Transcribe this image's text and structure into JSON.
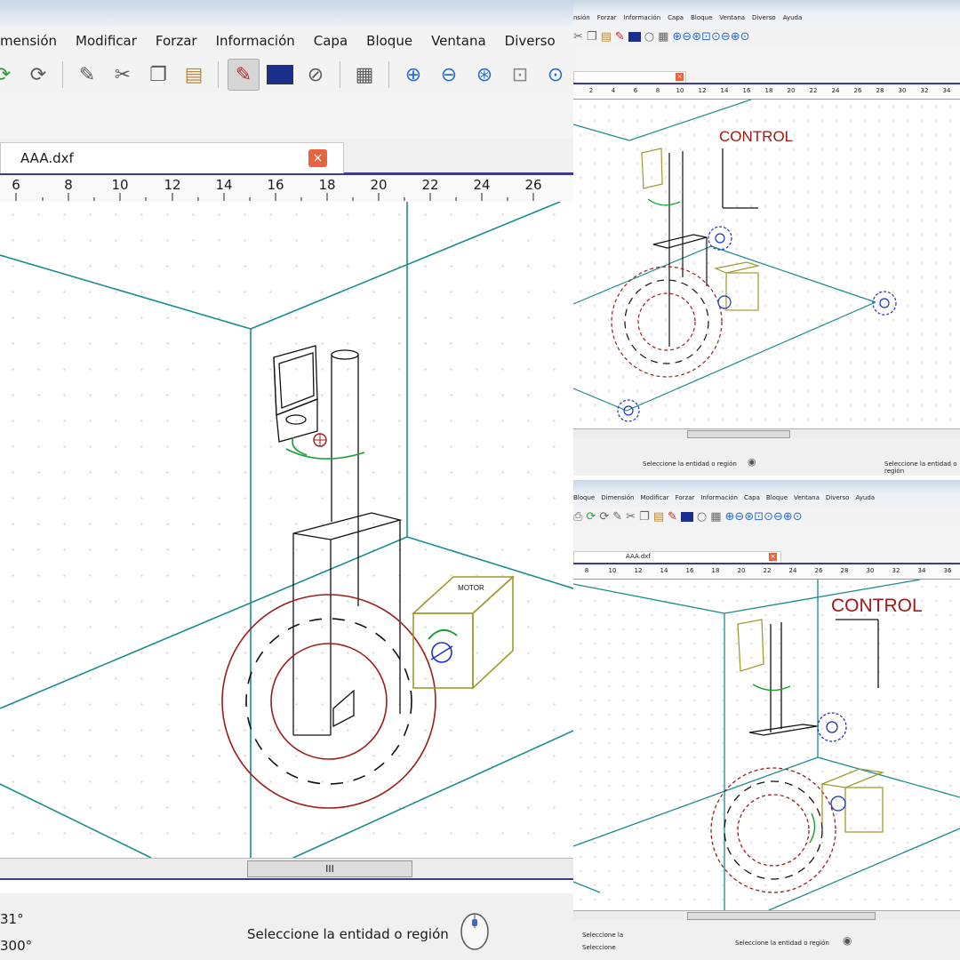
{
  "main": {
    "menu": [
      "mensión",
      "Modificar",
      "Forzar",
      "Información",
      "Capa",
      "Bloque",
      "Ventana",
      "Diverso"
    ],
    "toolbar_icons": [
      "redo-icon",
      "undo-icon",
      "pencil-icon",
      "scissors-icon",
      "copy-icon",
      "paste-icon",
      "draw-icon",
      "color-icon",
      "circle-slash-icon",
      "grid-icon",
      "zoom-in-icon",
      "zoom-out-icon",
      "zoom-auto-icon",
      "zoom-window-icon",
      "zoom-prev-icon"
    ],
    "tab": {
      "label": "AAA.dxf",
      "close": "×"
    },
    "ruler_ticks": [
      "6",
      "8",
      "10",
      "12",
      "14",
      "16",
      "18",
      "20",
      "22",
      "24",
      "26"
    ],
    "motor_label": "MOTOR",
    "scroll_thumb": "III",
    "status": {
      "coord1": "31°",
      "coord2": "300°",
      "message": "Seleccione la entidad o región"
    }
  },
  "top_right": {
    "menu": [
      "nsión",
      "Forzar",
      "Información",
      "Capa",
      "Bloque",
      "Ventana",
      "Diverso",
      "Ayuda"
    ],
    "ruler_ticks": [
      "2",
      "4",
      "6",
      "8",
      "10",
      "12",
      "14",
      "16",
      "18",
      "20",
      "22",
      "24",
      "26",
      "28",
      "30",
      "32",
      "34"
    ],
    "label": "CONTROL",
    "status_left": "Seleccione la entidad o región",
    "status_right": "Seleccione la entidad o región"
  },
  "bottom_right": {
    "menu": [
      "Bloque",
      "Dimensión",
      "Modificar",
      "Forzar",
      "Información",
      "Capa",
      "Bloque",
      "Ventana",
      "Diverso",
      "Ayuda"
    ],
    "tab_label": "AAA.dxf",
    "ruler_ticks": [
      "8",
      "10",
      "12",
      "14",
      "16",
      "18",
      "20",
      "22",
      "24",
      "26",
      "28",
      "30",
      "32",
      "34",
      "36"
    ],
    "label": "CONTROL",
    "status_left": "Seleccione la",
    "status_sub": "Seleccione",
    "status_message": "Seleccione la entidad o región"
  },
  "colors": {
    "teal": "#1a8c8c",
    "red": "#9b1c1c",
    "olive": "#a09a2c",
    "blue": "#1b2fc8",
    "green": "#15a02c",
    "accent": "#3c3c8c"
  }
}
